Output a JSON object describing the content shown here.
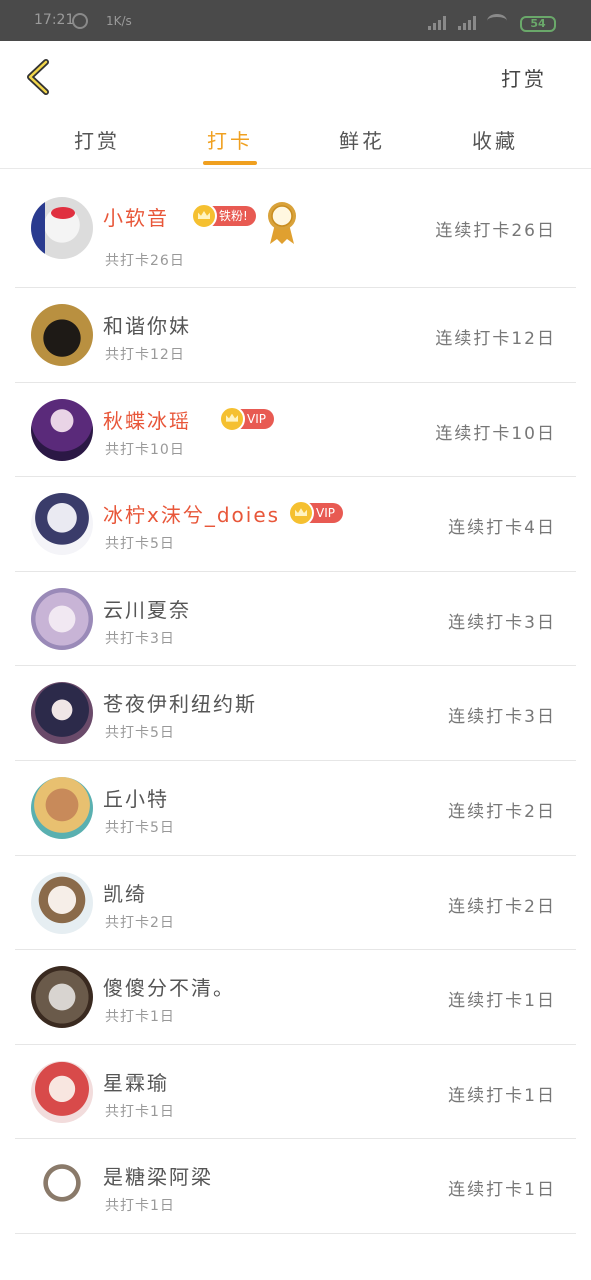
{
  "status_bar": {
    "time": "17:21",
    "speed": "1K/s",
    "battery": "54"
  },
  "header": {
    "action_label": "打赏"
  },
  "tabs": [
    {
      "label": "打赏",
      "active": false
    },
    {
      "label": "打卡",
      "active": true
    },
    {
      "label": "鲜花",
      "active": false
    },
    {
      "label": "收藏",
      "active": false
    }
  ],
  "colors": {
    "accent": "#f0a020",
    "name_vip": "#e8573a",
    "badge": "#e85a52"
  },
  "rows": [
    {
      "name": "小软音",
      "name_color": "red",
      "badge": "铁粉!",
      "medal": true,
      "total": "共打卡26日",
      "streak": "连续打卡26日"
    },
    {
      "name": "和谐你妹",
      "name_color": "normal",
      "total": "共打卡12日",
      "streak": "连续打卡12日"
    },
    {
      "name": "秋蝶冰瑶",
      "name_color": "red",
      "badge": "VIP",
      "total": "共打卡10日",
      "streak": "连续打卡10日"
    },
    {
      "name": "冰柠x沫兮_doies",
      "name_color": "red",
      "badge": "VIP",
      "total": "共打卡5日",
      "streak": "连续打卡4日"
    },
    {
      "name": "云川夏奈",
      "name_color": "normal",
      "total": "共打卡3日",
      "streak": "连续打卡3日"
    },
    {
      "name": "苍夜伊利纽约斯",
      "name_color": "normal",
      "total": "共打卡5日",
      "streak": "连续打卡3日"
    },
    {
      "name": "丘小特",
      "name_color": "normal",
      "total": "共打卡5日",
      "streak": "连续打卡2日"
    },
    {
      "name": "凯绮",
      "name_color": "normal",
      "total": "共打卡2日",
      "streak": "连续打卡2日"
    },
    {
      "name": "傻傻分不清。",
      "name_color": "normal",
      "total": "共打卡1日",
      "streak": "连续打卡1日"
    },
    {
      "name": "星霖瑜",
      "name_color": "normal",
      "total": "共打卡1日",
      "streak": "连续打卡1日"
    },
    {
      "name": "是糖梁阿梁",
      "name_color": "normal",
      "total": "共打卡1日",
      "streak": "连续打卡1日"
    }
  ]
}
